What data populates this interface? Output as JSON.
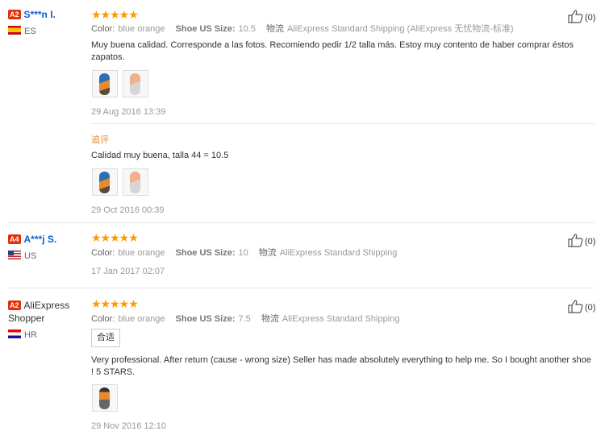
{
  "reviews": [
    {
      "badge": "A2",
      "name": "S***n I.",
      "name_link": true,
      "flag": "es",
      "country": "ES",
      "stars": "★★★★★",
      "color_label": "Color:",
      "color_value": "blue orange",
      "size_label": "Shoe US Size:",
      "size_value": "10.5",
      "ship_label": "物流",
      "ship_value": "AliExpress Standard Shipping (AliExpress 无忧物流-标准)",
      "text": "Muy buena calidad. Corresponde a las fotos. Recomiendo pedir 1/2 talla más. Estoy muy contento de haber comprar éstos zapatos.",
      "date": "29 Aug 2016 13:39",
      "likes": "(0)",
      "append_label": "追评",
      "append_text": "Calidad muy buena, talla 44 = 10.5",
      "append_date": "29 Oct 2016 00:39"
    },
    {
      "badge": "A4",
      "name": "A***j S.",
      "name_link": true,
      "flag": "us",
      "country": "US",
      "stars": "★★★★★",
      "color_label": "Color:",
      "color_value": "blue orange",
      "size_label": "Shoe US Size:",
      "size_value": "10",
      "ship_label": "物流",
      "ship_value": "AliExpress Standard Shipping",
      "date": "17 Jan 2017 02:07",
      "likes": "(0)"
    },
    {
      "badge": "A2",
      "name": "AliExpress Shopper",
      "name_link": false,
      "flag": "hr",
      "country": "HR",
      "stars": "★★★★★",
      "color_label": "Color:",
      "color_value": "blue orange",
      "size_label": "Shoe US Size:",
      "size_value": "7.5",
      "ship_label": "物流",
      "ship_value": "AliExpress Standard Shipping",
      "tag": "合适",
      "text": "Very professional. After return (cause - wrong size) Seller has made absolutely everything to help me. So I bought another shoe ! 5 STARS.",
      "date": "29 Nov 2016 12:10",
      "likes": "(0)"
    }
  ]
}
